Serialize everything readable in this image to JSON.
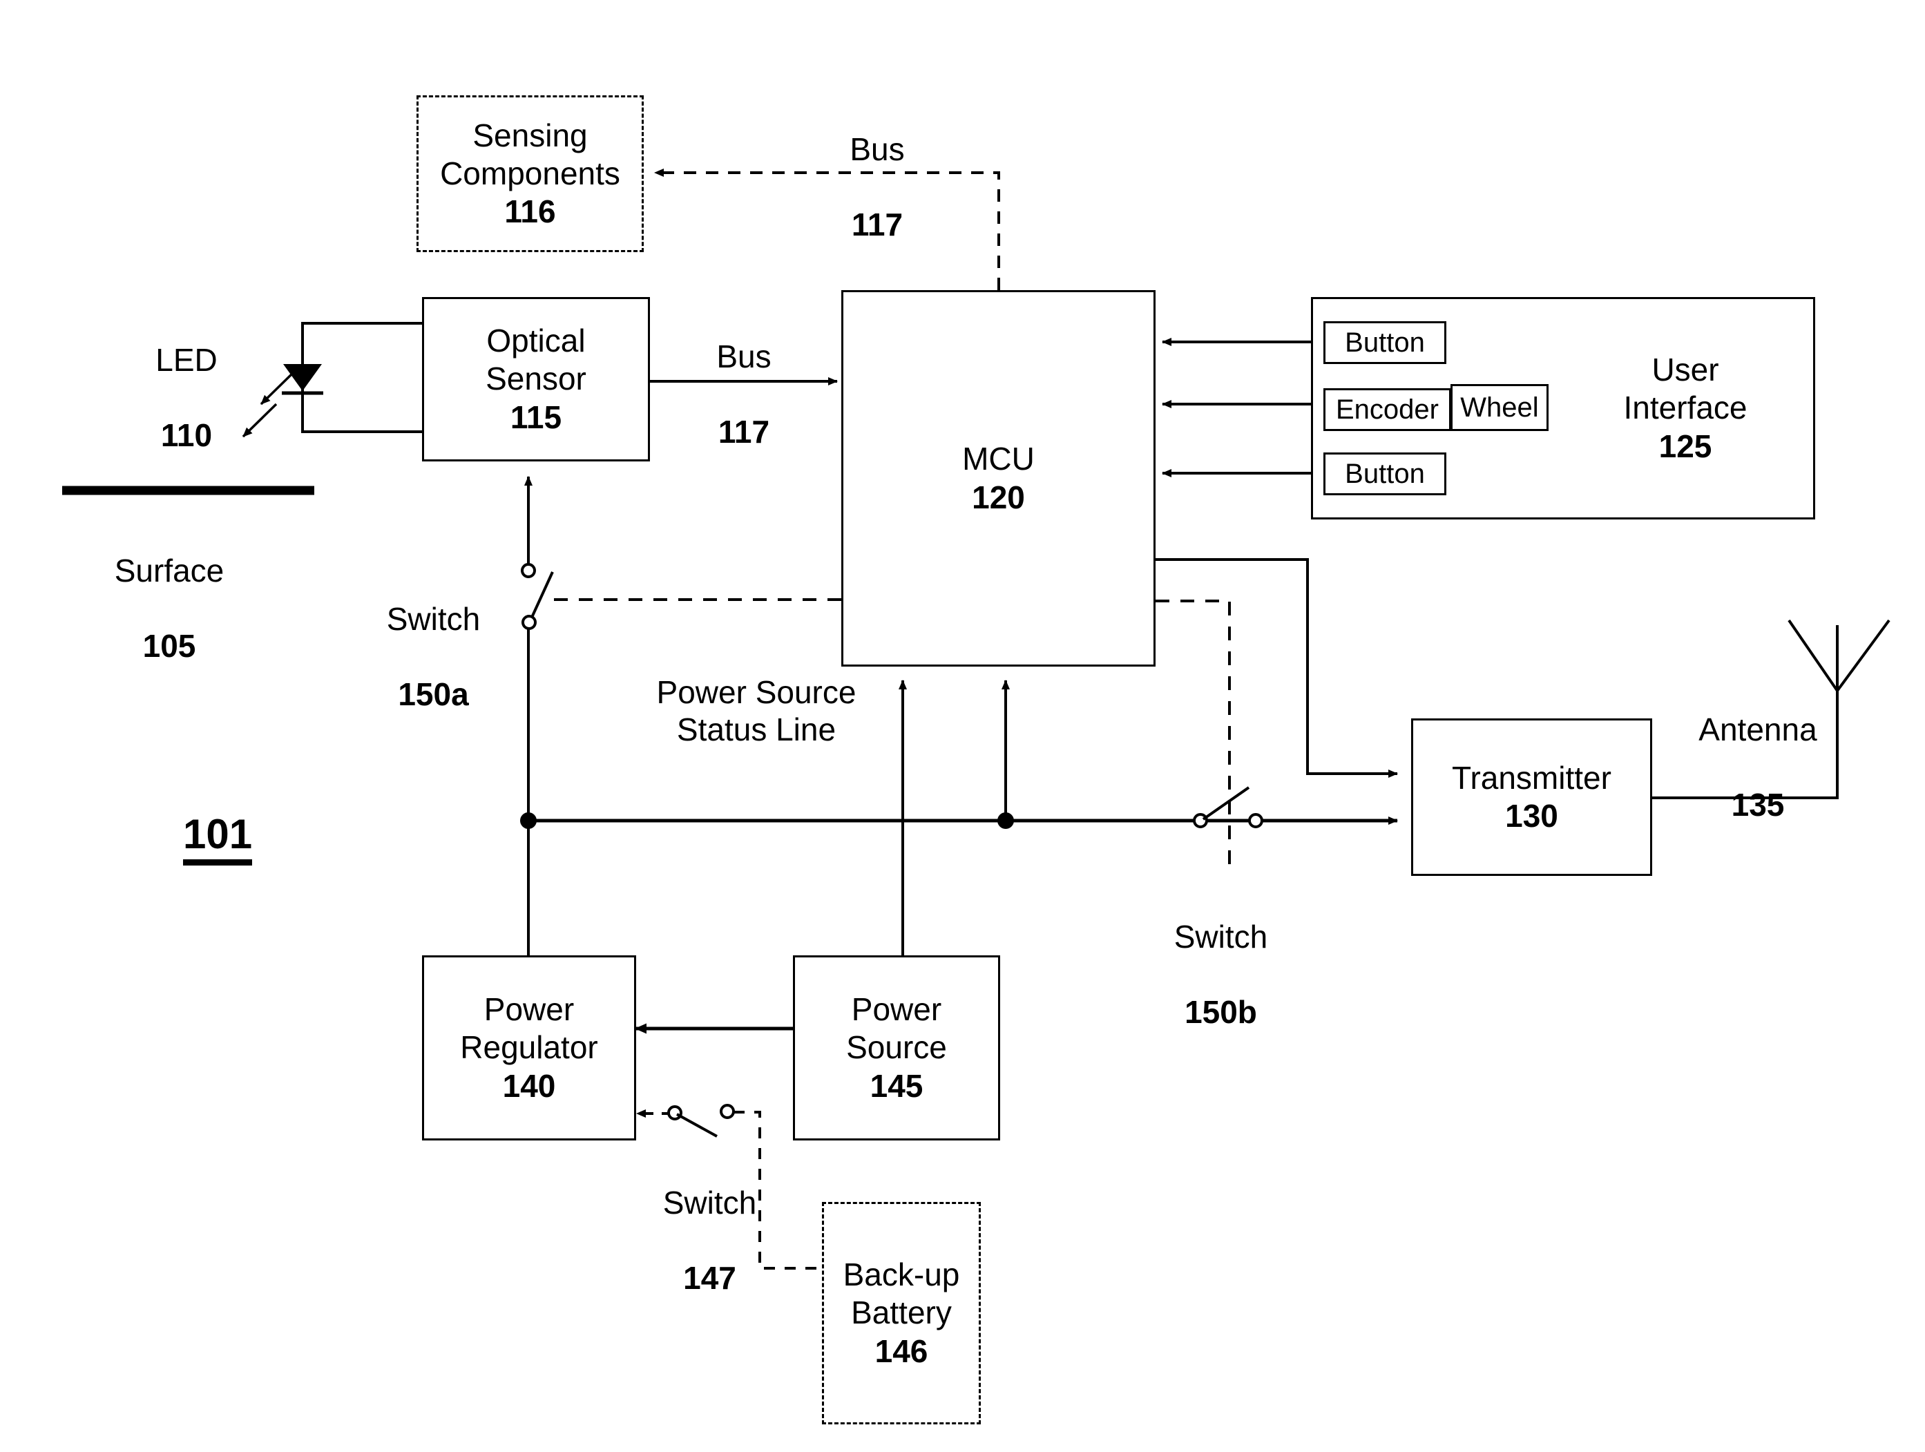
{
  "figure": {
    "ref_label": "101"
  },
  "blocks": {
    "sensing_components": {
      "title": "Sensing\nComponents",
      "ref": "116",
      "style": "dashed"
    },
    "optical_sensor": {
      "title": "Optical\nSensor",
      "ref": "115",
      "style": "solid"
    },
    "mcu": {
      "title": "MCU",
      "ref": "120",
      "style": "solid"
    },
    "user_interface": {
      "title": "User\nInterface",
      "ref": "125",
      "style": "solid"
    },
    "transmitter": {
      "title": "Transmitter",
      "ref": "130",
      "style": "solid"
    },
    "power_regulator": {
      "title": "Power\nRegulator",
      "ref": "140",
      "style": "solid"
    },
    "power_source": {
      "title": "Power\nSource",
      "ref": "145",
      "style": "solid"
    },
    "backup_battery": {
      "title": "Back-up\nBattery",
      "ref": "146",
      "style": "dashed"
    }
  },
  "ui_controls": {
    "button_top": "Button",
    "encoder": "Encoder",
    "wheel": "Wheel",
    "button_bottom": "Button"
  },
  "labels": {
    "led": {
      "name": "LED",
      "ref": "110"
    },
    "surface": {
      "name": "Surface",
      "ref": "105"
    },
    "bus_top": {
      "name": "Bus",
      "ref": "117"
    },
    "bus_middle": {
      "name": "Bus",
      "ref": "117"
    },
    "switch_150a": {
      "name": "Switch",
      "ref": "150a"
    },
    "switch_150b": {
      "name": "Switch",
      "ref": "150b"
    },
    "switch_147": {
      "name": "Switch",
      "ref": "147"
    },
    "antenna": {
      "name": "Antenna",
      "ref": "135"
    },
    "power_status_line": {
      "text": "Power Source\nStatus Line"
    }
  },
  "colors": {
    "ink": "#000000",
    "paper": "#ffffff"
  }
}
